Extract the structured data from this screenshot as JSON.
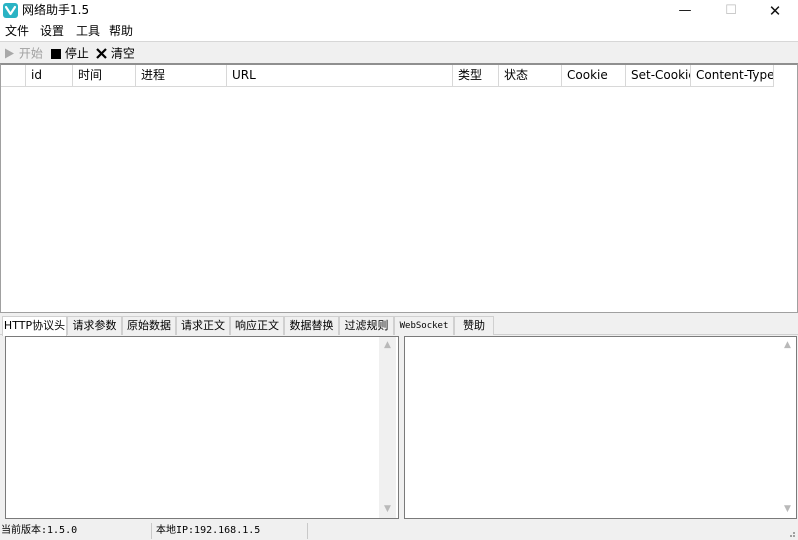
{
  "window": {
    "title": "网络助手1.5",
    "minimize": "—",
    "maximize": "☐",
    "close": "✕"
  },
  "menu": [
    "文件",
    "设置",
    "工具",
    "帮助"
  ],
  "toolbar": {
    "start_label": "开始",
    "stop_label": "停止",
    "clear_label": "清空"
  },
  "table": {
    "columns": [
      "id",
      "时间",
      "进程",
      "URL",
      "类型",
      "状态",
      "Cookie",
      "Set-Cookie",
      "Content-Type"
    ],
    "rows": []
  },
  "tabs": [
    "HTTP协议头",
    "请求参数",
    "原始数据",
    "请求正文",
    "响应正文",
    "数据替换",
    "过滤规则",
    "WebSocket",
    "赞助"
  ],
  "active_tab": "HTTP协议头",
  "panes": {
    "left_value": "",
    "right_value": "",
    "scroll_up": "▲",
    "scroll_down": "▼"
  },
  "status": {
    "version": "当前版本:1.5.0",
    "local_ip": "本地IP:192.168.1.5"
  }
}
